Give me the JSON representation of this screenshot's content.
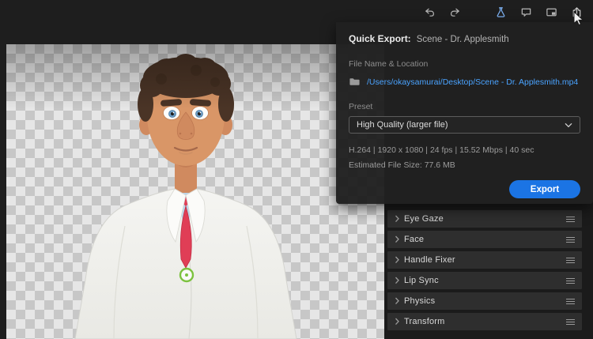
{
  "toolbar": {
    "icons": [
      "undo-icon",
      "redo-icon",
      "flask-icon",
      "comment-icon",
      "pip-icon",
      "share-export-icon"
    ]
  },
  "quick_export": {
    "title_label": "Quick Export:",
    "scene_name": "Scene - Dr. Applesmith",
    "file_label": "File Name & Location",
    "file_path": "/Users/okaysamurai/Desktop/Scene - Dr. Applesmith.mp4",
    "preset_label": "Preset",
    "preset_value": "High Quality (larger file)",
    "info_line": "H.264 | 1920 x 1080 | 24 fps | 15.52 Mbps | 40 sec",
    "estimated_size": "Estimated File Size: 77.6 MB",
    "export_label": "Export"
  },
  "properties": {
    "items": [
      "Eye Gaze",
      "Face",
      "Handle Fixer",
      "Lip Sync",
      "Physics",
      "Transform"
    ]
  },
  "colors": {
    "accent": "#1b74e4",
    "link": "#4aa3ff",
    "badge-green": "#7cc23f"
  }
}
